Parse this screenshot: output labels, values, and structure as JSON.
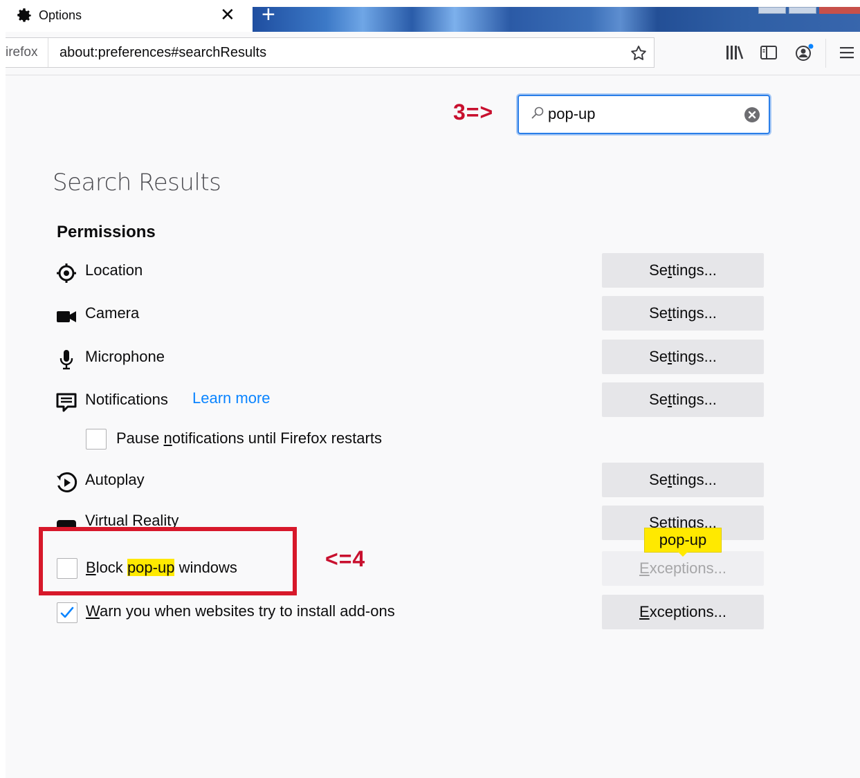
{
  "tab": {
    "title": "Options",
    "close_glyph": "✕",
    "new_tab_glyph": "+"
  },
  "navbar": {
    "identity": "irefox",
    "url": "about:preferences#searchResults"
  },
  "search": {
    "value": "pop-up"
  },
  "annotations": {
    "step3": "3=>",
    "step4": "<=4"
  },
  "content": {
    "title": "Search Results",
    "permissions_heading": "Permissions",
    "permissions": [
      {
        "label": "Location",
        "icon": "location-icon",
        "button": "Settings..."
      },
      {
        "label": "Camera",
        "icon": "camera-icon",
        "button": "Settings..."
      },
      {
        "label": "Microphone",
        "icon": "microphone-icon",
        "button": "Settings..."
      },
      {
        "label": "Notifications",
        "icon": "notifications-icon",
        "button": "Settings...",
        "link": "Learn more"
      },
      {
        "label": "Autoplay",
        "icon": "autoplay-icon",
        "button": "Settings..."
      },
      {
        "label": "Virtual Reality",
        "icon": "vr-icon",
        "button": "Settings..."
      }
    ],
    "pause_notifications": {
      "label": "Pause notifications until Firefox restarts",
      "checked": false
    },
    "block_popups": {
      "label_before": "Block ",
      "highlight": "pop-up",
      "label_after": " windows",
      "checked": false,
      "button": "Exceptions..."
    },
    "warn_addons": {
      "label": "Warn you when websites try to install add-ons",
      "checked": true,
      "button": "Exceptions..."
    },
    "tooltip": "pop-up"
  },
  "colors": {
    "accent": "#0a84ff",
    "highlight": "#ffe900",
    "annotation": "#c8102e",
    "button_bg": "#e6e6e9"
  }
}
